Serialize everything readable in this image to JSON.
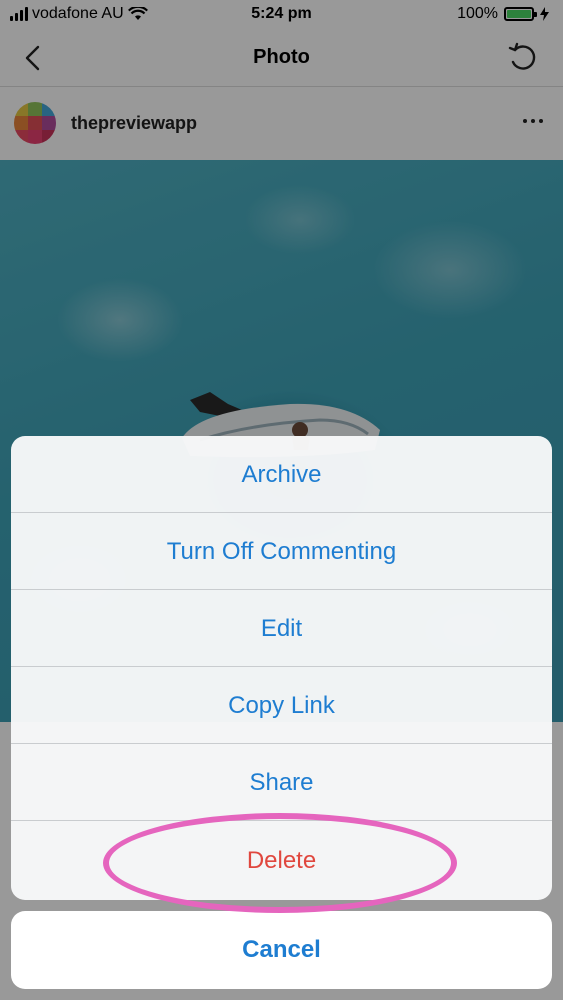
{
  "status_bar": {
    "carrier": "vodafone AU",
    "time": "5:24 pm",
    "battery_percent": "100%",
    "battery_level": 1.0,
    "battery_color": "#4cd964"
  },
  "nav": {
    "title": "Photo",
    "back_icon": "chevron-left-icon",
    "refresh_icon": "refresh-icon"
  },
  "post": {
    "username": "thepreviewapp",
    "avatar_colors": [
      "#e3c644",
      "#8fc45a",
      "#43a7d9",
      "#e8843b",
      "#df4f57",
      "#b04b9c",
      "#e84a62",
      "#e84070",
      "#c8325a"
    ],
    "more_icon": "more-dots-icon"
  },
  "action_sheet": {
    "items": [
      {
        "label": "Archive"
      },
      {
        "label": "Turn Off Commenting"
      },
      {
        "label": "Edit"
      },
      {
        "label": "Copy Link"
      },
      {
        "label": "Share"
      },
      {
        "label": "Delete"
      }
    ],
    "cancel_label": "Cancel",
    "accent_color": "#1e7dd1",
    "destructive_color": "#e0473e",
    "highlight_color": "#e565be"
  }
}
